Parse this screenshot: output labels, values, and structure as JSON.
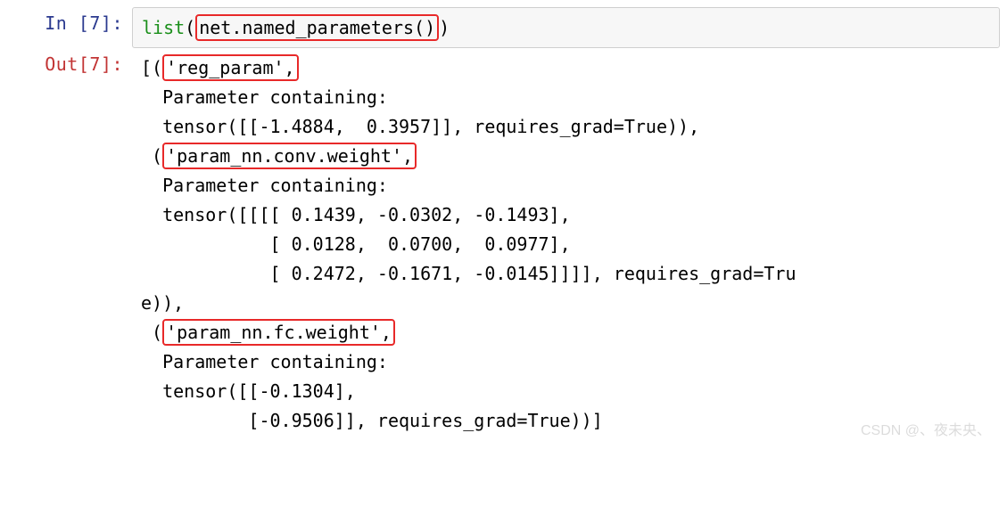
{
  "prompt": {
    "in_label": "In  [7]:",
    "out_label": "Out[7]:"
  },
  "input": {
    "func": "list",
    "lparen": "(",
    "highlighted": "net.named_parameters()",
    "rparen": ")"
  },
  "output": {
    "l01_pre": "[(",
    "l01_box": "'reg_param',",
    "l02": "  Parameter containing:",
    "l03": "  tensor([[-1.4884,  0.3957]], requires_grad=True)),",
    "l04_pre": " (",
    "l04_box": "'param_nn.conv.weight',",
    "l05": "  Parameter containing:",
    "l06": "  tensor([[[[ 0.1439, -0.0302, -0.1493],",
    "l07": "            [ 0.0128,  0.0700,  0.0977],",
    "l08": "            [ 0.2472, -0.1671, -0.0145]]]], requires_grad=Tru",
    "l09": "e)),",
    "l10_pre": " (",
    "l10_box": "'param_nn.fc.weight',",
    "l11": "  Parameter containing:",
    "l12": "  tensor([[-0.1304],",
    "l13": "          [-0.9506]], requires_grad=True))]"
  },
  "watermark": "CSDN @、夜未央、"
}
